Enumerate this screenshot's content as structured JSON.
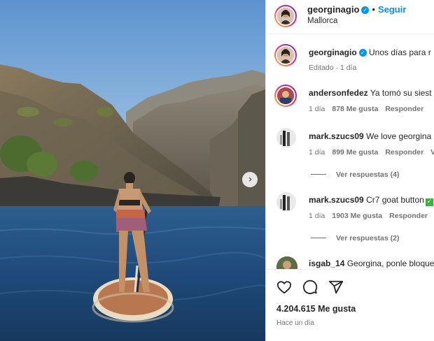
{
  "post": {
    "author": "georginagio",
    "location": "Mallorca",
    "follow_label": "Seguir",
    "separator": "•",
    "caption_text": "Unos días para r",
    "caption_meta": "Editado · 1 día",
    "likes": "4.204.615 Me gusta",
    "time": "Hace un día"
  },
  "comments": [
    {
      "user": "andersonfedez",
      "text": "Ya tomó su siest",
      "age": "1 día",
      "likes": "878 Me gusta",
      "reply": "Responder"
    },
    {
      "user": "mark.szucs09",
      "text": "We love georgina",
      "age": "1 día",
      "likes": "899 Me gusta",
      "reply": "Responder",
      "extra": "V",
      "replies": "Ver respuestas (4)"
    },
    {
      "user": "mark.szucs09",
      "text": "Cr7 goat button",
      "age": "1 día",
      "likes": "1903 Me gusta",
      "reply": "Responder",
      "replies": "Ver respuestas (2)"
    },
    {
      "user": "isgab_14",
      "text": "Georgina, ponle bloque"
    }
  ],
  "icons": [
    "heart-icon",
    "comment-icon",
    "share-icon",
    "verified-icon",
    "chevron-right-icon"
  ],
  "colors": {
    "accent": "#0095f6",
    "text": "#262626",
    "muted": "#737373",
    "border": "#efefef",
    "emoji_green": "#3cb043"
  }
}
